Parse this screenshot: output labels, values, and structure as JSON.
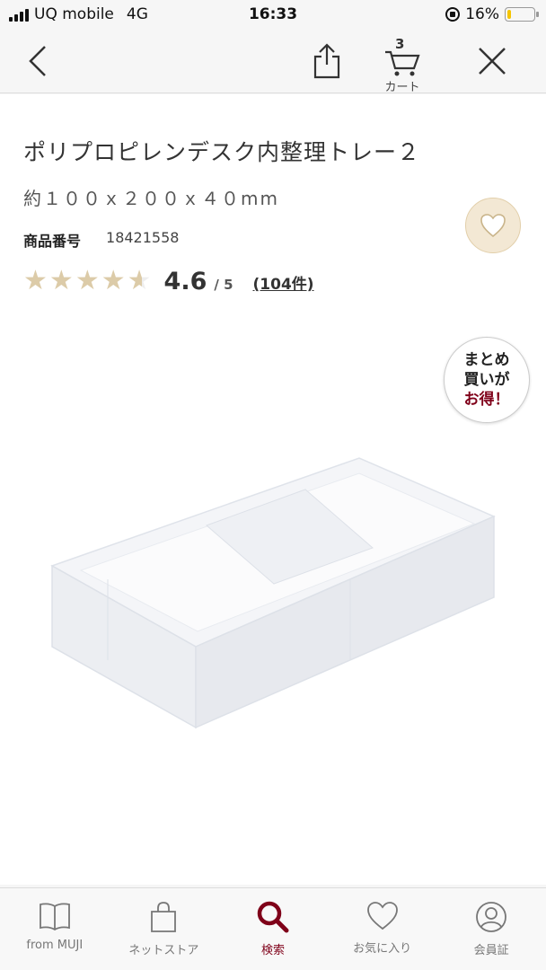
{
  "status": {
    "carrier": "UQ mobile",
    "network": "4G",
    "time": "16:33",
    "battery_percent": "16%",
    "battery_level": 0.16
  },
  "nav": {
    "cart_count": "3",
    "cart_label": "カート",
    "icons": [
      "back-icon",
      "share-icon",
      "cart-icon",
      "close-icon"
    ]
  },
  "product": {
    "title": "ポリプロピレンデスク内整理トレー２",
    "size": "約１００ｘ２００ｘ４０mm",
    "code_label": "商品番号",
    "code": "18421558",
    "rating_value": "4.6",
    "rating_max": "/ 5",
    "rating_count": "(104件)",
    "rating": 4.6
  },
  "promo": {
    "line1": "まとめ",
    "line2": "買いが",
    "line3": "お得！"
  },
  "colors": {
    "accent": "#7f0019",
    "star": "#dccba8",
    "fav_bg": "#f3e8d4"
  },
  "tabs": [
    {
      "label": "from MUJI",
      "icon": "book-icon"
    },
    {
      "label": "ネットストア",
      "icon": "bag-icon"
    },
    {
      "label": "検索",
      "icon": "search-icon",
      "active": true
    },
    {
      "label": "お気に入り",
      "icon": "heart-icon"
    },
    {
      "label": "会員証",
      "icon": "member-icon"
    }
  ]
}
